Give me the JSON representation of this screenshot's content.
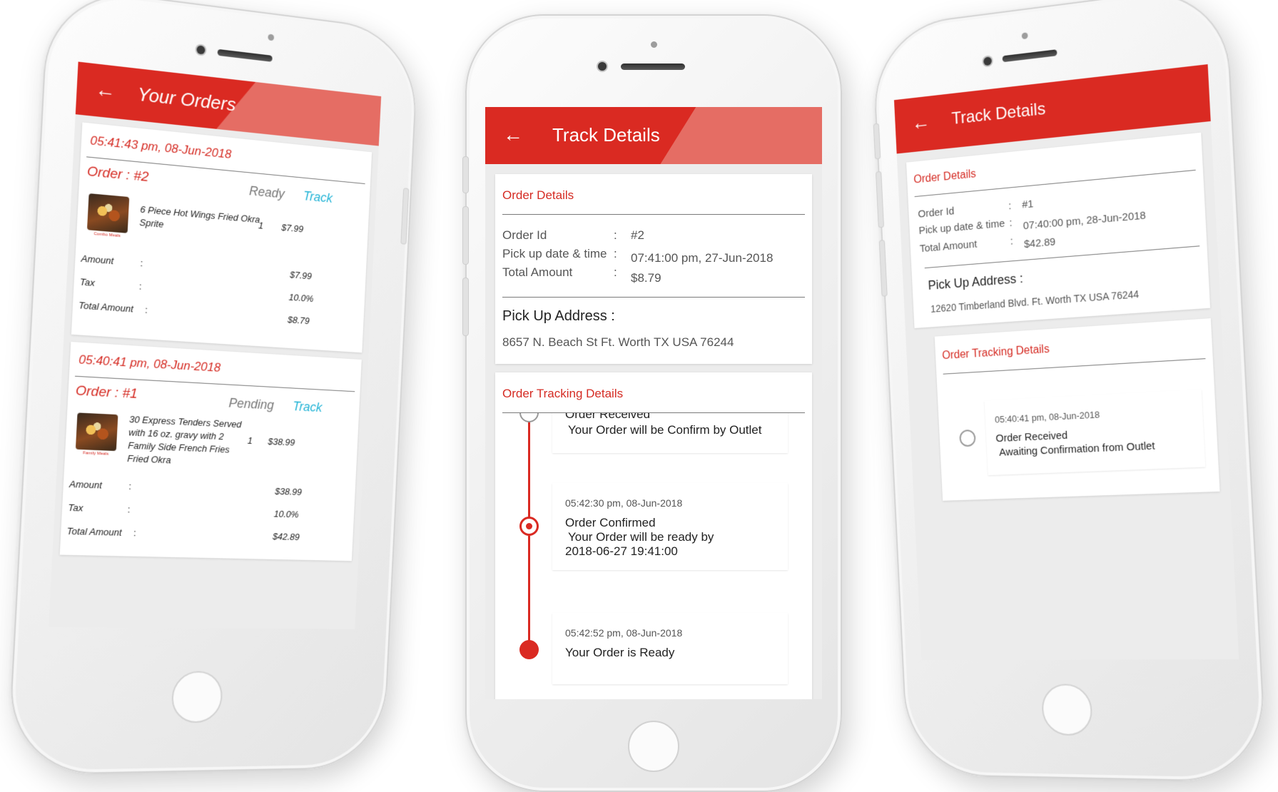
{
  "theme": {
    "primary": "#da2a22",
    "accent": "#e56d64",
    "track_link": "#24b4d6",
    "screen_bg": "#ececec"
  },
  "phone1": {
    "appbar": {
      "back_icon": "arrow-left-icon",
      "title": "Your Orders"
    },
    "orders": [
      {
        "timestamp": "05:41:43 pm, 08-Jun-2018",
        "order_label": "Order  :  #2",
        "status": "Ready",
        "track_label": "Track",
        "item": {
          "image_caption": "Combo Meals",
          "name_line1": "6 Piece Hot Wings Fried Okra",
          "name_line2": "Sprite",
          "qty": "1",
          "price": "$7.99"
        },
        "summary": [
          {
            "label": "Amount",
            "sep": ":",
            "value": "$7.99"
          },
          {
            "label": "Tax",
            "sep": ":",
            "value": "10.0%"
          },
          {
            "label": "Total Amount",
            "sep": ":",
            "value": "$8.79"
          }
        ]
      },
      {
        "timestamp": "05:40:41 pm, 08-Jun-2018",
        "order_label": "Order  :  #1",
        "status": "Pending",
        "track_label": "Track",
        "item": {
          "image_caption": "Family Meals",
          "name_line1": "30 Express Tenders Served",
          "name_line2": "with 16 oz. gravy with 2",
          "name_line3": "Family Side French Fries",
          "name_line4": "Fried Okra",
          "qty": "1",
          "price": "$38.99"
        },
        "summary": [
          {
            "label": "Amount",
            "sep": ":",
            "value": "$38.99"
          },
          {
            "label": "Tax",
            "sep": ":",
            "value": "10.0%"
          },
          {
            "label": "Total Amount",
            "sep": ":",
            "value": "$42.89"
          }
        ]
      }
    ]
  },
  "phone2": {
    "appbar": {
      "back_icon": "arrow-left-icon",
      "title": "Track Details"
    },
    "order_details": {
      "title": "Order Details",
      "rows": [
        {
          "label": "Order Id",
          "sep": ":",
          "value": "#2"
        },
        {
          "label": "Pick up date & time",
          "sep": ":",
          "value": "07:41:00 pm, 27-Jun-2018"
        },
        {
          "label": "Total Amount",
          "sep": ":",
          "value": "$8.79"
        }
      ],
      "address_label": "Pick Up Address  :",
      "address": "8657 N. Beach St Ft.  Worth TX USA 76244"
    },
    "tracking": {
      "title": "Order Tracking Details",
      "steps": [
        {
          "time": "",
          "title": "Order Received",
          "detail": "Your Order will be Confirm by Outlet"
        },
        {
          "time": "05:42:30 pm, 08-Jun-2018",
          "title": "Order Confirmed",
          "detail": "Your Order will be ready by",
          "detail2": "2018-06-27 19:41:00"
        },
        {
          "time": "05:42:52 pm, 08-Jun-2018",
          "title": "Your Order is Ready"
        }
      ]
    }
  },
  "phone3": {
    "appbar": {
      "back_icon": "arrow-left-icon",
      "title": "Track Details"
    },
    "order_details": {
      "title": "Order Details",
      "rows": [
        {
          "label": "Order Id",
          "sep": ":",
          "value": "#1"
        },
        {
          "label": "Pick up date & time",
          "sep": ":",
          "value": "07:40:00 pm, 28-Jun-2018"
        },
        {
          "label": "Total Amount",
          "sep": ":",
          "value": "$42.89"
        }
      ],
      "address_label": "Pick Up Address  :",
      "address": "12620 Timberland Blvd. Ft. Worth TX USA 76244"
    },
    "tracking": {
      "title": "Order Tracking Details",
      "steps": [
        {
          "time": "05:40:41 pm, 08-Jun-2018",
          "title": "Order Received",
          "detail": "Awaiting Confirmation from Outlet"
        }
      ]
    }
  }
}
